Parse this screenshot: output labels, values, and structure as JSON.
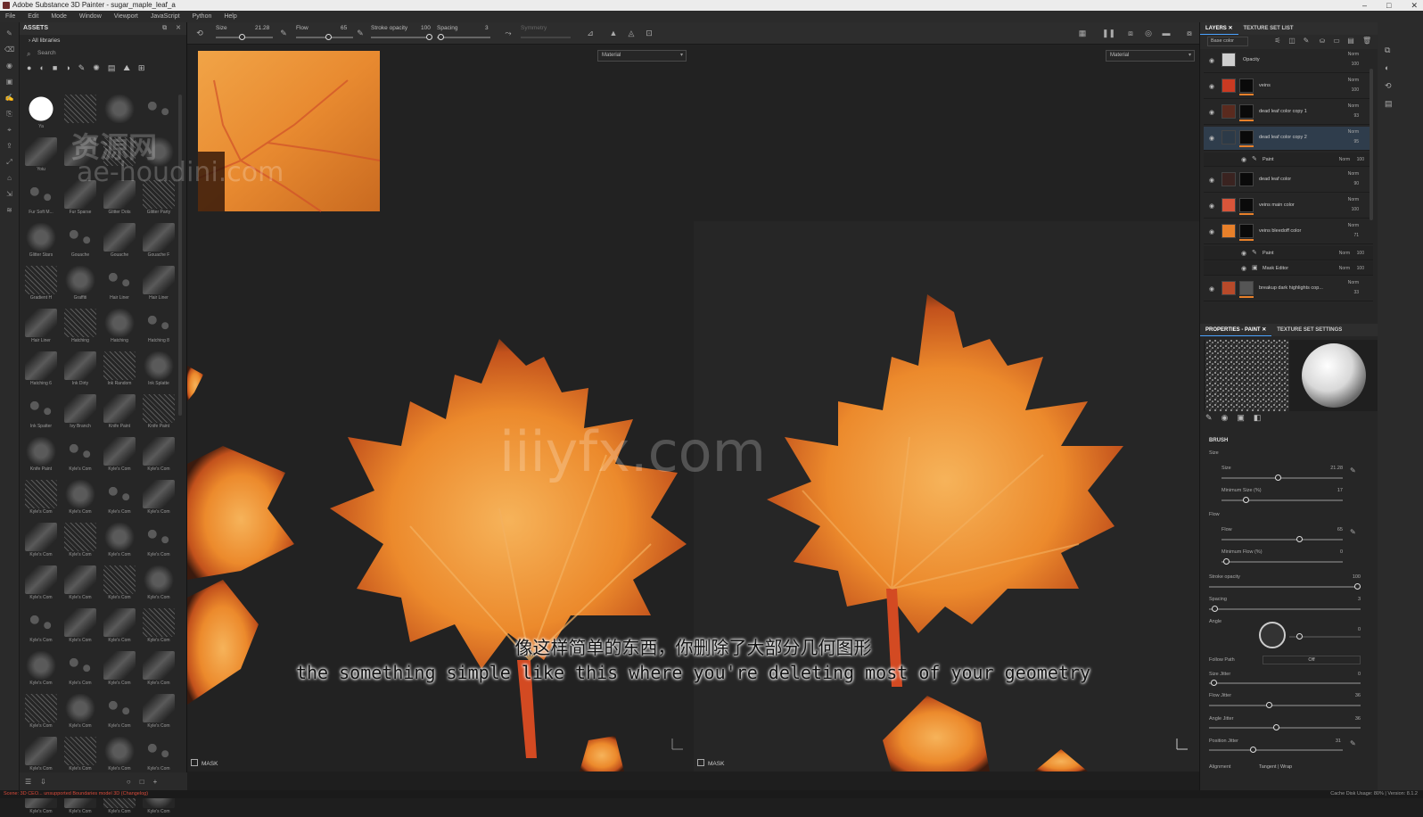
{
  "window": {
    "title": "Adobe Substance 3D Painter - sugar_maple_leaf_a"
  },
  "menu": [
    "File",
    "Edit",
    "Mode",
    "Window",
    "Viewport",
    "JavaScript",
    "Python",
    "Help"
  ],
  "assets": {
    "title": "ASSETS",
    "library": "All libraries",
    "search_placeholder": "Search",
    "items": [
      "Ya",
      "",
      "",
      "",
      "Yoiu",
      "",
      "",
      "",
      "Fur Soft M...",
      "Fur Sparse",
      "Glitter Dots",
      "Glitter Party",
      "Glitter Stars",
      "Gouache",
      "Gouache",
      "Gouache F",
      "Gradient H",
      "Graffiti",
      "Hair Liner",
      "Hair Liner",
      "Hair Liner",
      "Hatching",
      "Hatching",
      "Hatching 8",
      "Hatching 6",
      "Ink Dirty",
      "Ink Random",
      "Ink Splatte",
      "Ink Spatter",
      "Ivy Branch",
      "Knife Paint",
      "Knife Paint",
      "Knife Paint",
      "Kyle's Com",
      "Kyle's Com",
      "Kyle's Com",
      "Kyle's Com",
      "Kyle's Com",
      "Kyle's Com",
      "Kyle's Com",
      "Kyle's Com",
      "Kyle's Com",
      "Kyle's Com",
      "Kyle's Com",
      "Kyle's Com",
      "Kyle's Com",
      "Kyle's Com",
      "Kyle's Com",
      "Kyle's Com",
      "Kyle's Com",
      "Kyle's Com",
      "Kyle's Com",
      "Kyle's Com",
      "Kyle's Com",
      "Kyle's Com",
      "Kyle's Com",
      "Kyle's Com",
      "Kyle's Com",
      "Kyle's Com",
      "Kyle's Com",
      "Kyle's Com",
      "Kyle's Com",
      "Kyle's Com",
      "Kyle's Com",
      "Kyle's Com",
      "Kyle's Com",
      "Kyle's Com",
      "Kyle's Com"
    ]
  },
  "toolbar": {
    "size_label": "Size",
    "size_value": "21.28",
    "flow_label": "Flow",
    "flow_value": "65",
    "stroke_label": "Stroke opacity",
    "stroke_value": "100",
    "spacing_label": "Spacing",
    "spacing_value": "3",
    "symmetry_label": "Symmetry"
  },
  "viewport": {
    "material_left": "Material",
    "material_right": "Material",
    "mask_left": "MASK",
    "mask_right": "MASK"
  },
  "subtitles": {
    "zh": "像这样简单的东西，你删除了大部分几何图形",
    "en": "the something simple like this where you're deleting most of your geometry"
  },
  "watermarks": {
    "a": "资源网",
    "b": "ae-houdini.com",
    "c": "iiiyfx.com"
  },
  "layers_panel": {
    "tab_layers": "LAYERS",
    "tab_texture_set_list": "TEXTURE SET LIST",
    "channel": "Base color",
    "layers": [
      {
        "name": "Opacity",
        "blend": "Norm",
        "opacity": "100",
        "color": "#cfcfcf"
      },
      {
        "name": "veins",
        "blend": "Norm",
        "opacity": "100",
        "color": "#c93a22"
      },
      {
        "name": "dead leaf color copy 1",
        "blend": "Norm",
        "opacity": "93",
        "color": "#5a2a1e"
      },
      {
        "name": "dead leaf color copy 2",
        "blend": "Norm",
        "opacity": "95",
        "color": "#2c3a48"
      },
      {
        "name": "dead leaf color",
        "blend": "Norm",
        "opacity": "90",
        "color": "#3a2320"
      },
      {
        "name": "veins main color",
        "blend": "Norm",
        "opacity": "100",
        "color": "#d8553a"
      },
      {
        "name": "veins bleedoff color",
        "blend": "Norm",
        "opacity": "71",
        "color": "#e8802a"
      },
      {
        "name": "breakup dark highlights cop...",
        "blend": "Norm",
        "opacity": "33",
        "color": "#b84a2a"
      }
    ],
    "sub_paint_1": {
      "name": "Paint",
      "blend": "Norm",
      "opacity": "100"
    },
    "sub_paint_2": {
      "name": "Paint",
      "blend": "Norm",
      "opacity": "100"
    },
    "sub_mask_editor": {
      "name": "Mask Editor",
      "blend": "Norm",
      "opacity": "100"
    }
  },
  "properties": {
    "tab_props": "PROPERTIES - PAINT",
    "tab_texture": "TEXTURE SET SETTINGS",
    "brush_title": "BRUSH",
    "size_group": "Size",
    "size_label": "Size",
    "size_value": "21.28",
    "min_size_label": "Minimum Size (%)",
    "min_size_value": "17",
    "flow_group": "Flow",
    "flow_label": "Flow",
    "flow_value": "65",
    "min_flow_label": "Minimum Flow (%)",
    "min_flow_value": "0",
    "stroke_label": "Stroke opacity",
    "stroke_value": "100",
    "spacing_label": "Spacing",
    "spacing_value": "3",
    "angle_label": "Angle",
    "angle_value": "0",
    "follow_path_label": "Follow Path",
    "follow_path_value": "Off",
    "size_jitter_label": "Size Jitter",
    "size_jitter_value": "0",
    "flow_jitter_label": "Flow Jitter",
    "flow_jitter_value": "36",
    "angle_jitter_label": "Angle Jitter",
    "angle_jitter_value": "36",
    "position_jitter_label": "Position Jitter",
    "position_jitter_value": "31",
    "alignment_label": "Alignment",
    "alignment_value": "Tangent | Wrap"
  },
  "status": {
    "left": "Scene: 3D CEO... unsupported Boundaries model 3D (Changelog)",
    "right": "Cache Disk Usage: 80% | Version: 8.1.2"
  },
  "colors": {
    "accent": "#4aa3ff",
    "leaf_orange": "#e8802a",
    "leaf_dark": "#3a1a0e"
  }
}
